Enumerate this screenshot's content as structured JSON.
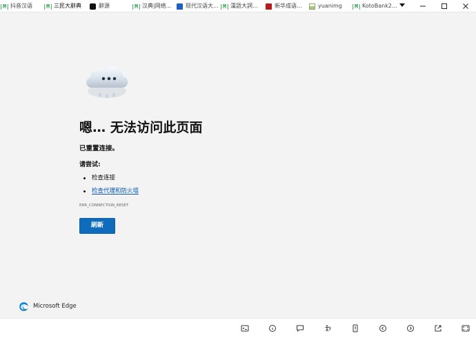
{
  "tabs": [
    {
      "label": "抖音汉语",
      "icon": "m-icon"
    },
    {
      "label": "三民大辭典",
      "icon": "m-icon"
    },
    {
      "label": "辭源",
      "icon": "dark-square-icon"
    },
    {
      "label": "汉典|网络...",
      "icon": "m-icon"
    },
    {
      "label": "现代汉语大...",
      "icon": "book-icon"
    },
    {
      "label": "漢語大詞...",
      "icon": "m-icon"
    },
    {
      "label": "新华成语...",
      "icon": "red-square-icon"
    },
    {
      "label": "yuanimg",
      "icon": "document-icon"
    },
    {
      "label": "KotoBank2...",
      "icon": "m-icon"
    }
  ],
  "error": {
    "title": "嗯… 无法访问此页面",
    "subtitle": "已重置连接。",
    "try_label": "请尝试:",
    "suggestions": [
      {
        "label": "检查连接",
        "link": false
      },
      {
        "label": "检查代理和防火墙",
        "link": true
      }
    ],
    "code": "ERR_CONNECTION_RESET",
    "refresh_label": "刷新"
  },
  "brand": {
    "name": "Microsoft Edge"
  },
  "icons": {
    "tabs_dropdown": "dropdown-arrow-icon",
    "minimize": "minimize-icon",
    "maximize": "maximize-icon",
    "close": "close-icon",
    "error_cloud": "cloud-ellipsis-icon",
    "brand_logo": "edge-logo-icon",
    "bottom": [
      "terminal-icon",
      "info-icon",
      "comment-icon",
      "accessibility-icon",
      "mobile-icon",
      "back-icon",
      "forward-icon",
      "external-link-icon",
      "screen-icon"
    ]
  },
  "colors": {
    "page_background": "#f3f3f3",
    "link": "#0b57b7",
    "primary_button": "#0f6cbd",
    "edge_blue": "#0b6fd1",
    "edge_green": "#24b45c"
  }
}
